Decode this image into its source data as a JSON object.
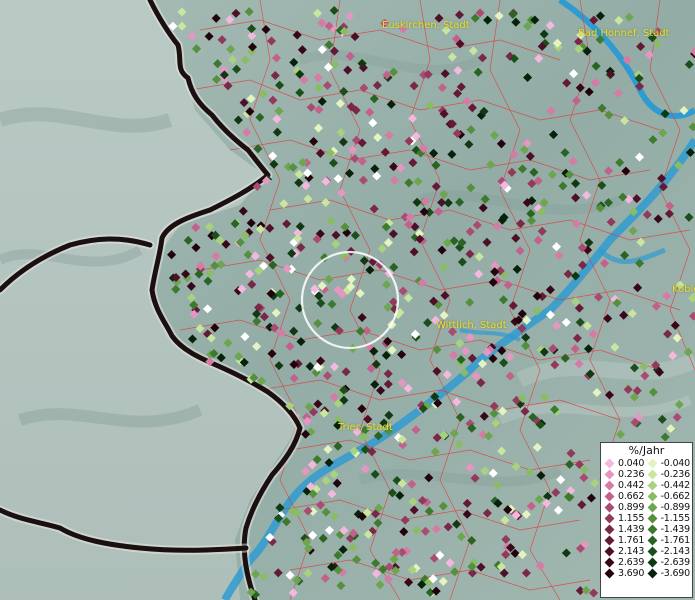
{
  "map": {
    "towns": [
      {
        "name": "Euskirchen, Stadt"
      },
      {
        "name": "Bad Honnef, Stadt"
      },
      {
        "name": "Wittlich, Stadt"
      },
      {
        "name": "Trier, Stadt"
      },
      {
        "name": "Koble"
      }
    ],
    "colors": {
      "border": "#1a1010",
      "admin_lines": "#e03a3a",
      "water": "#2f9bd0",
      "relief": "#9bb4ad",
      "label": "#e8e020"
    }
  },
  "legend": {
    "title": "%/Jahr",
    "positive": [
      {
        "label": "0.040",
        "color": "#f4b8de"
      },
      {
        "label": "0.236",
        "color": "#e696c2"
      },
      {
        "label": "0.442",
        "color": "#d67aa6"
      },
      {
        "label": "0.662",
        "color": "#c2628a"
      },
      {
        "label": "0.899",
        "color": "#aa4c72"
      },
      {
        "label": "1.155",
        "color": "#92395c"
      },
      {
        "label": "1.439",
        "color": "#7a2848"
      },
      {
        "label": "1.761",
        "color": "#641a36"
      },
      {
        "label": "2.143",
        "color": "#4e1026"
      },
      {
        "label": "2.639",
        "color": "#38081a"
      },
      {
        "label": "3.690",
        "color": "#22030c"
      }
    ],
    "negative": [
      {
        "label": "-0.040",
        "color": "#e4f4c0"
      },
      {
        "label": "-0.236",
        "color": "#c8e69e"
      },
      {
        "label": "-0.442",
        "color": "#a8d27e"
      },
      {
        "label": "-0.662",
        "color": "#8abc66"
      },
      {
        "label": "-0.899",
        "color": "#6ea650"
      },
      {
        "label": "-1.155",
        "color": "#55903e"
      },
      {
        "label": "-1.439",
        "color": "#3c7a2e"
      },
      {
        "label": "-1.761",
        "color": "#2a6424"
      },
      {
        "label": "-2.143",
        "color": "#1c4e1a"
      },
      {
        "label": "-2.639",
        "color": "#103812"
      },
      {
        "label": "-3.690",
        "color": "#06220a"
      }
    ]
  }
}
